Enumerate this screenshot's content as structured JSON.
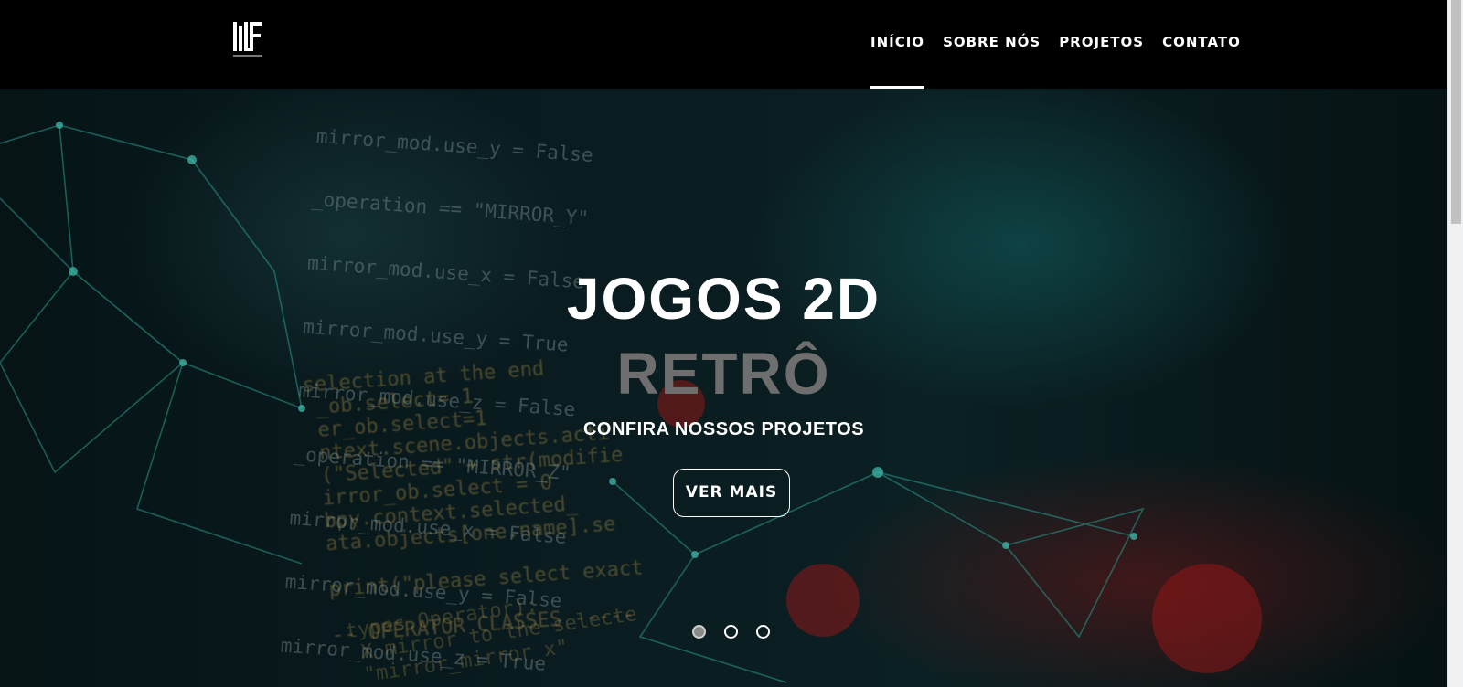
{
  "brand": {
    "logo_icon": "mlf-logo-icon"
  },
  "nav": {
    "items": [
      {
        "label": "INÍCIO",
        "active": true
      },
      {
        "label": "SOBRE NÓS",
        "active": false
      },
      {
        "label": "PROJETOS",
        "active": false
      },
      {
        "label": "CONTATO",
        "active": false
      }
    ]
  },
  "hero": {
    "title": "JOGOS 2D",
    "subtitle": "RETRÔ",
    "tagline": "CONFIRA NOSSOS PROJETOS",
    "button_label": "VER MAIS",
    "slides_count": 3,
    "active_slide": 1
  },
  "colors": {
    "nav_bg": "#000000",
    "subtitle": "#6e6e6e",
    "text": "#ffffff"
  }
}
